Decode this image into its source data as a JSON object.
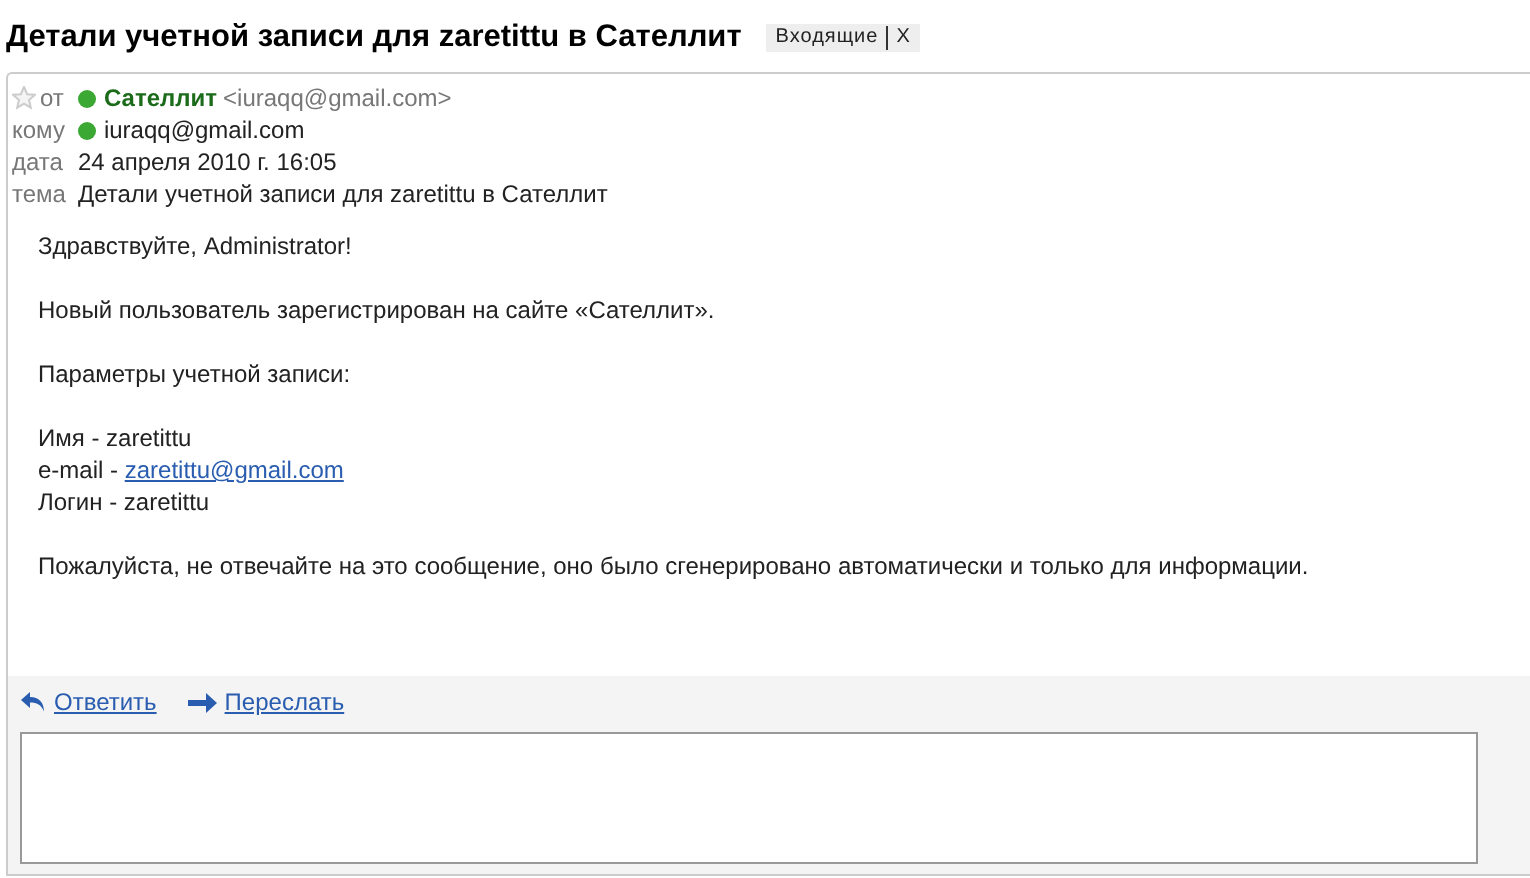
{
  "title": "Детали учетной записи для zaretittu в Сателлит",
  "labels": [
    {
      "text": "Входящие",
      "remove": "X"
    }
  ],
  "message": {
    "starred": false,
    "headers": [
      {
        "label": "от",
        "online": true,
        "name": "Сателлит",
        "value": "<iuraqq@gmail.com>"
      },
      {
        "label": "кому",
        "online": true,
        "value": "iuraqq@gmail.com"
      },
      {
        "label": "дата",
        "value": "24 апреля 2010 г. 16:05"
      },
      {
        "label": "тема",
        "value": "Детали учетной записи для zaretittu в Сателлит"
      }
    ],
    "paragraphs": [
      [
        {
          "text": "Здравствуйте, Administrator!"
        }
      ],
      [
        {
          "text": "Новый пользователь зарегистрирован на сайте «Сателлит»."
        }
      ],
      [
        {
          "text": "Параметры учетной записи:"
        }
      ],
      [
        {
          "text": "Имя - zaretittu"
        },
        {
          "text": "e-mail - ",
          "link": "zaretittu@gmail.com"
        },
        {
          "text": "Логин - zaretittu"
        }
      ],
      [
        {
          "text": "Пожалуйста, не отвечайте на это сообщение, оно было сгенерировано автоматически и только для информации."
        }
      ]
    ],
    "actions": [
      {
        "kind": "reply",
        "label": "Ответить"
      },
      {
        "kind": "forward",
        "label": "Переслать"
      }
    ]
  }
}
